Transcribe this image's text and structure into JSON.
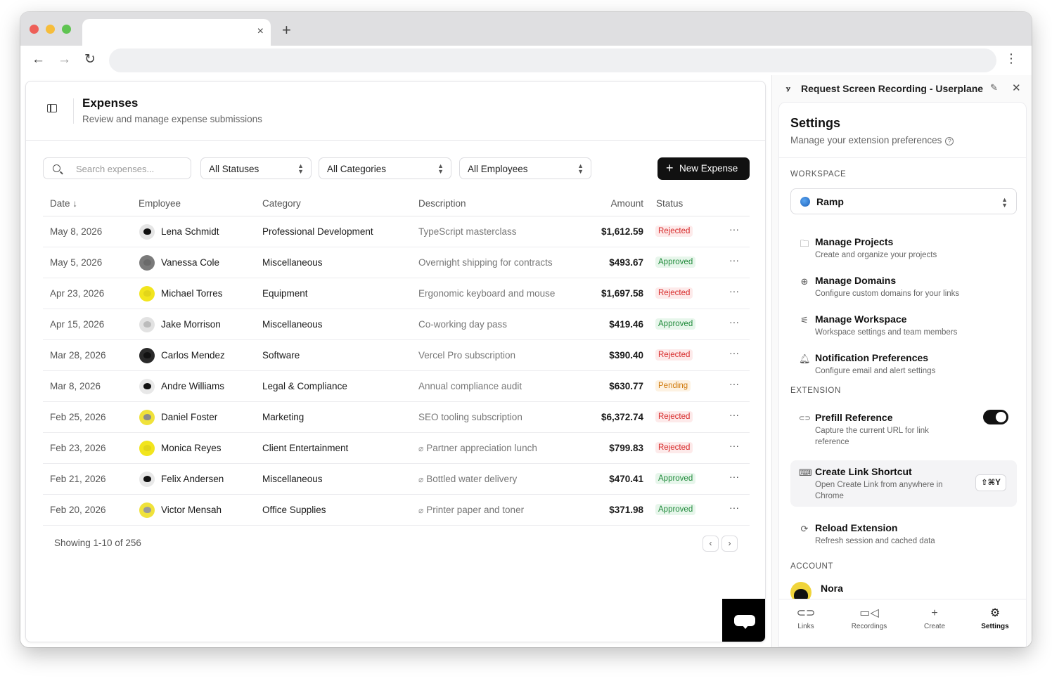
{
  "browser": {
    "tab_close": "×",
    "new_tab": "+",
    "back": "←",
    "forward": "→",
    "reload": "↻",
    "menu": "⋮"
  },
  "header": {
    "title": "Expenses",
    "subtitle": "Review and manage expense submissions"
  },
  "filters": {
    "search_placeholder": "Search expenses...",
    "status": "All Statuses",
    "category": "All Categories",
    "employee": "All Employees",
    "new_button": "New Expense",
    "new_button_icon": "+"
  },
  "table": {
    "columns": {
      "date": "Date ↓",
      "employee": "Employee",
      "category": "Category",
      "description": "Description",
      "amount": "Amount",
      "status": "Status"
    },
    "rows": [
      {
        "date": "May 8, 2026",
        "employee": "Lena Schmidt",
        "category": "Professional Development",
        "description": "TypeScript masterclass",
        "attachment": false,
        "amount": "$1,612.59",
        "status": "Rejected",
        "avatar_bg": "#e5e5e5",
        "avatar_face": "#111111"
      },
      {
        "date": "May 5, 2026",
        "employee": "Vanessa Cole",
        "category": "Miscellaneous",
        "description": "Overnight shipping for contracts",
        "attachment": false,
        "amount": "$493.67",
        "status": "Approved",
        "avatar_bg": "#7a7a7a",
        "avatar_face": "#6a6a6a"
      },
      {
        "date": "Apr 23, 2026",
        "employee": "Michael Torres",
        "category": "Equipment",
        "description": "Ergonomic keyboard and mouse",
        "attachment": false,
        "amount": "$1,697.58",
        "status": "Rejected",
        "avatar_bg": "#f2e51d",
        "avatar_face": "#e2d51a"
      },
      {
        "date": "Apr 15, 2026",
        "employee": "Jake Morrison",
        "category": "Miscellaneous",
        "description": "Co-working day pass",
        "attachment": false,
        "amount": "$419.46",
        "status": "Approved",
        "avatar_bg": "#e2e2e2",
        "avatar_face": "#bcbcbc"
      },
      {
        "date": "Mar 28, 2026",
        "employee": "Carlos Mendez",
        "category": "Software",
        "description": "Vercel Pro subscription",
        "attachment": false,
        "amount": "$390.40",
        "status": "Rejected",
        "avatar_bg": "#2a2a2a",
        "avatar_face": "#111111"
      },
      {
        "date": "Mar 8, 2026",
        "employee": "Andre Williams",
        "category": "Legal & Compliance",
        "description": "Annual compliance audit",
        "attachment": false,
        "amount": "$630.77",
        "status": "Pending",
        "avatar_bg": "#e8e8e8",
        "avatar_face": "#111111"
      },
      {
        "date": "Feb 25, 2026",
        "employee": "Daniel Foster",
        "category": "Marketing",
        "description": "SEO tooling subscription",
        "attachment": false,
        "amount": "$6,372.74",
        "status": "Rejected",
        "avatar_bg": "#f0e23a",
        "avatar_face": "#8c8c8c"
      },
      {
        "date": "Feb 23, 2026",
        "employee": "Monica Reyes",
        "category": "Client Entertainment",
        "description": "Partner appreciation lunch",
        "attachment": true,
        "amount": "$799.83",
        "status": "Rejected",
        "avatar_bg": "#f2e51d",
        "avatar_face": "#e2d51a"
      },
      {
        "date": "Feb 21, 2026",
        "employee": "Felix Andersen",
        "category": "Miscellaneous",
        "description": "Bottled water delivery",
        "attachment": true,
        "amount": "$470.41",
        "status": "Approved",
        "avatar_bg": "#e8e8e8",
        "avatar_face": "#111111"
      },
      {
        "date": "Feb 20, 2026",
        "employee": "Victor Mensah",
        "category": "Office Supplies",
        "description": "Printer paper and toner",
        "attachment": true,
        "amount": "$371.98",
        "status": "Approved",
        "avatar_bg": "#f0e23a",
        "avatar_face": "#9a9a9a"
      }
    ],
    "row_menu": "···",
    "footer": "Showing 1-10 of 256",
    "prev": "‹",
    "next": "›"
  },
  "extension": {
    "title": "Request Screen Recording - Userplane",
    "logo": "ꭹ",
    "pin_icon": "✎",
    "close_icon": "✕",
    "settings_title": "Settings",
    "settings_subtitle": "Manage your extension preferences",
    "help_glyph": "?",
    "workspace_label": "WORKSPACE",
    "workspace_name": "Ramp",
    "workspace_items": [
      {
        "icon": "🗀",
        "title": "Manage Projects",
        "desc": "Create and organize your projects"
      },
      {
        "icon": "⊕",
        "title": "Manage Domains",
        "desc": "Configure custom domains for your links"
      },
      {
        "icon": "⚟",
        "title": "Manage Workspace",
        "desc": "Workspace settings and team members"
      },
      {
        "icon": "🔔︎",
        "title": "Notification Preferences",
        "desc": "Configure email and alert settings"
      }
    ],
    "extension_label": "EXTENSION",
    "prefill": {
      "icon": "⊂⊃",
      "title": "Prefill Reference",
      "desc": "Capture the current URL for link reference",
      "enabled": true
    },
    "shortcut": {
      "icon": "⌨",
      "title": "Create Link Shortcut",
      "desc": "Open Create Link from anywhere in Chrome",
      "keys": "⇧⌘Y"
    },
    "reload": {
      "icon": "⟳",
      "title": "Reload Extension",
      "desc": "Refresh session and cached data"
    },
    "account_label": "ACCOUNT",
    "account_name": "Nora",
    "nav": [
      {
        "icon": "⊂⊃",
        "label": "Links"
      },
      {
        "icon": "▭◁",
        "label": "Recordings"
      },
      {
        "icon": "+",
        "label": "Create"
      },
      {
        "icon": "⚙",
        "label": "Settings",
        "active": true
      }
    ]
  },
  "colors": {
    "rejected": "#d72a2a",
    "approved": "#1f8a3a",
    "pending": "#d07a0b",
    "primary_button": "#111111"
  }
}
